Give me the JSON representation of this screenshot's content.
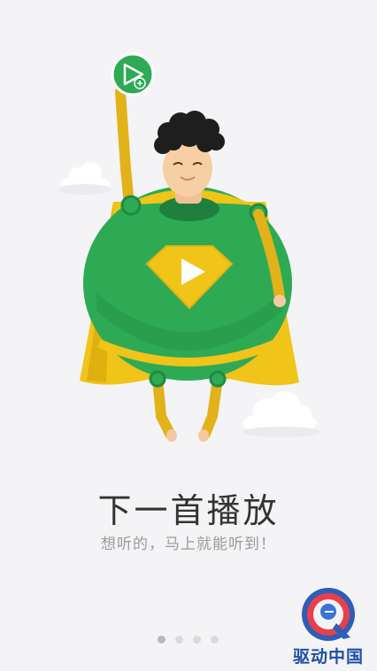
{
  "onboarding": {
    "title": "下一首播放",
    "subtitle": "想听的，马上就能听到！"
  },
  "pager": {
    "count": 4,
    "active_index": 0
  },
  "watermark": {
    "text": "驱动中国"
  },
  "colors": {
    "background": "#f4f4f6",
    "suit_green": "#2eaa55",
    "cape_yellow": "#f0c419",
    "title_text": "#333333",
    "subtitle_text": "#9a9a9a"
  },
  "icons": {
    "hand_badge": "play-plus-icon",
    "chest_emblem": "play-icon"
  }
}
